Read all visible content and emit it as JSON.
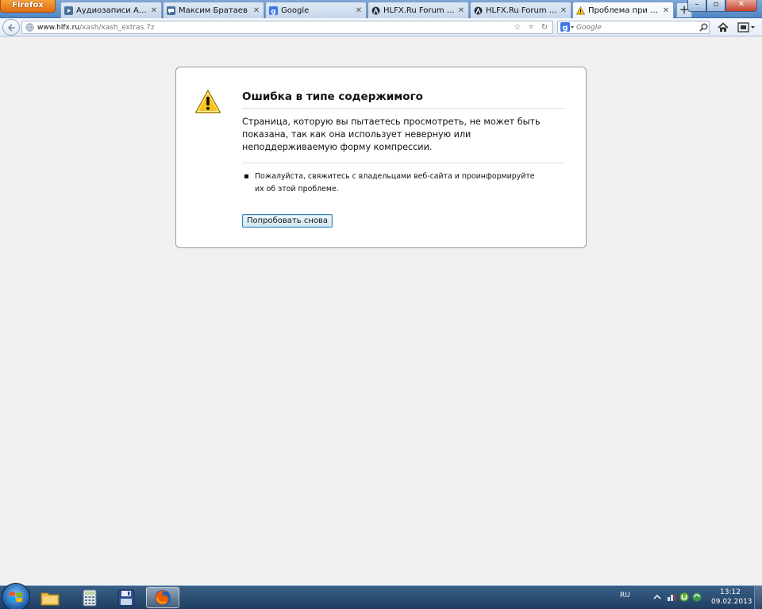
{
  "browser": {
    "menu_button_label": "Firefox",
    "tabs": [
      {
        "title": "Аудиозаписи Алекса...",
        "icon": "vk-audio-icon",
        "active": false
      },
      {
        "title": "Максим Братаев",
        "icon": "vk-chat-icon",
        "active": false
      },
      {
        "title": "Google",
        "icon": "google-icon",
        "active": false
      },
      {
        "title": "HLFX.Ru Forum - Xash...",
        "icon": "half-life-icon",
        "active": false
      },
      {
        "title": "HLFX.Ru Forum - Xash...",
        "icon": "half-life-icon",
        "active": false
      },
      {
        "title": "Проблема при загруз...",
        "icon": "warning-icon",
        "active": true
      }
    ],
    "new_tab_label": "+",
    "window_controls": {
      "minimize": "–",
      "maximize": "▫",
      "close": "✕"
    }
  },
  "navbar": {
    "url_domain": "www.hlfx.ru",
    "url_path": "/xash/xash_extras.7z",
    "search_placeholder": "Google"
  },
  "error": {
    "title": "Ошибка в типе содержимого",
    "description": "Страница, которую вы пытаетесь просмотреть, не может быть показана, так как она использует неверную или неподдерживаемую форму компрессии.",
    "suggestions": [
      "Пожалуйста, свяжитесь с владельцами веб-сайта и проинформируйте их об этой проблеме."
    ],
    "retry_label": "Попробовать снова"
  },
  "taskbar": {
    "language": "RU",
    "time": "13:12",
    "date": "09.02.2013"
  },
  "colors": {
    "firefox_orange": "#e26a10",
    "retry_border": "#3c7fb1",
    "warning_yellow": "#f5c518"
  }
}
